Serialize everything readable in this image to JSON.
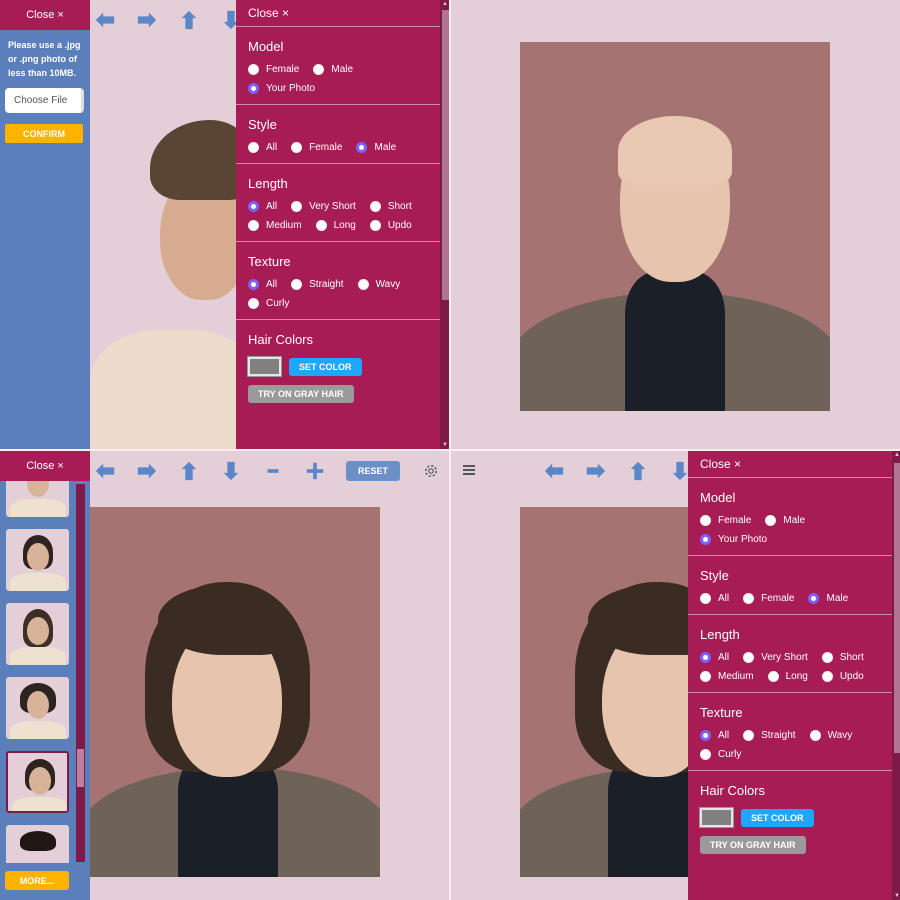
{
  "colors": {
    "accent": "#a81c55",
    "sidebar": "#5b7fba",
    "background": "#e4cfd9",
    "confirm": "#ffb300",
    "set_color": "#1ea7fd",
    "radio_selected": "#7b61ff",
    "hair_swatch": "#808080"
  },
  "upload_panel": {
    "close_label": "Close ×",
    "note": "Please use a .jpg or .png photo of less than 10MB.",
    "file_button_label": "Choose File",
    "confirm_label": "CONFIRM"
  },
  "toolbar": {
    "icons": [
      "arrow-left-icon",
      "arrow-right-icon",
      "arrow-up-icon",
      "arrow-down-icon",
      "minus-icon",
      "plus-icon"
    ],
    "reset_label": "RESET",
    "settings_icon": "gear-icon",
    "menu_icon": "hamburger-menu-icon"
  },
  "filter_panel": {
    "close_label": "Close ×",
    "sections": {
      "model": {
        "title": "Model",
        "options": [
          {
            "label": "Female",
            "selected": false
          },
          {
            "label": "Male",
            "selected": false
          },
          {
            "label": "Your Photo",
            "selected": true
          }
        ]
      },
      "style": {
        "title": "Style",
        "options": [
          {
            "label": "All",
            "selected": false
          },
          {
            "label": "Female",
            "selected": false
          },
          {
            "label": "Male",
            "selected": true
          }
        ]
      },
      "length": {
        "title": "Length",
        "options": [
          {
            "label": "All",
            "selected": true
          },
          {
            "label": "Very Short",
            "selected": false
          },
          {
            "label": "Short",
            "selected": false
          },
          {
            "label": "Medium",
            "selected": false
          },
          {
            "label": "Long",
            "selected": false
          },
          {
            "label": "Updo",
            "selected": false
          }
        ]
      },
      "texture": {
        "title": "Texture",
        "options": [
          {
            "label": "All",
            "selected": true
          },
          {
            "label": "Straight",
            "selected": false
          },
          {
            "label": "Wavy",
            "selected": false
          },
          {
            "label": "Curly",
            "selected": false
          }
        ]
      },
      "hair_colors": {
        "title": "Hair Colors",
        "set_color_label": "SET COLOR",
        "gray_hair_label": "TRY ON GRAY HAIR"
      }
    }
  },
  "thumbnails": {
    "count_visible": 6,
    "selected_index": 4,
    "more_label": "MORE..."
  },
  "photos": {
    "top_left": "half-face preview of man with brown bowl cut",
    "top_right": "bald man in black turtleneck and grey coat",
    "bottom_left": "man with medium-length shaggy brown hair in black turtleneck and grey coat",
    "bottom_right": "man with medium-length shaggy brown hair (partially covered by filter panel)"
  }
}
